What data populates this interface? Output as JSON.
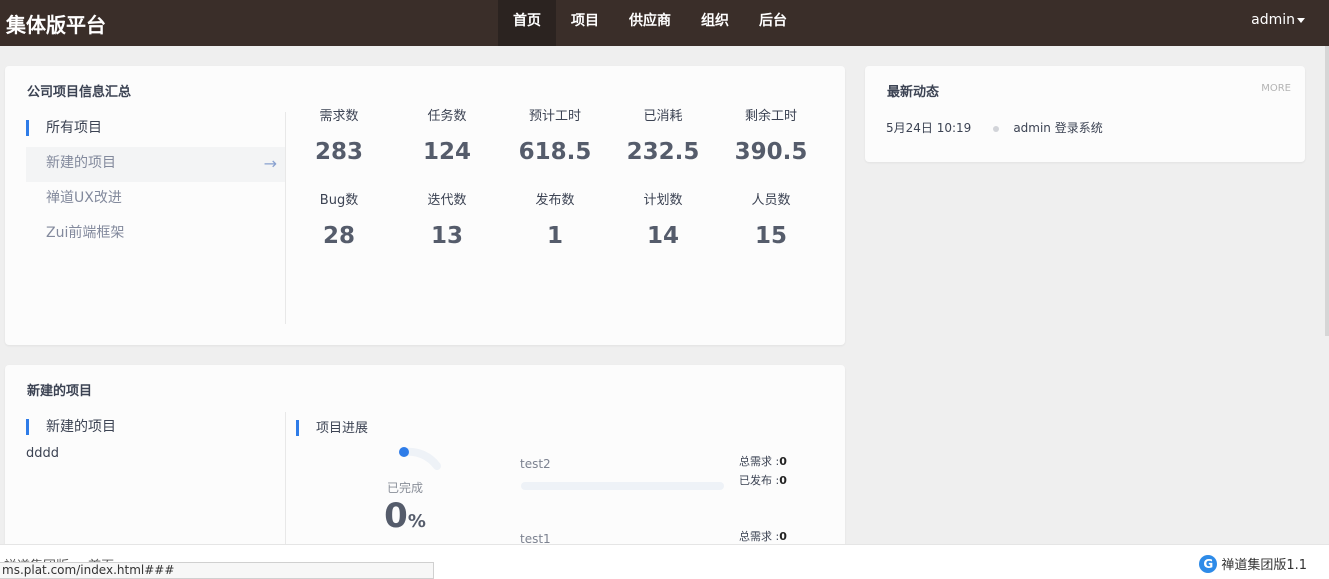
{
  "header": {
    "brand": "集体版平台",
    "nav": [
      "首页",
      "项目",
      "供应商",
      "组织",
      "后台"
    ],
    "active_nav": "首页",
    "user": "admin"
  },
  "summary": {
    "title": "公司项目信息汇总",
    "projects": [
      "所有项目",
      "新建的项目",
      "禅道UX改进",
      "Zui前端框架"
    ],
    "stats": [
      {
        "label": "需求数",
        "value": "283"
      },
      {
        "label": "任务数",
        "value": "124"
      },
      {
        "label": "预计工时",
        "value": "618.5"
      },
      {
        "label": "已消耗",
        "value": "232.5"
      },
      {
        "label": "剩余工时",
        "value": "390.5"
      },
      {
        "label": "Bug数",
        "value": "28"
      },
      {
        "label": "迭代数",
        "value": "13"
      },
      {
        "label": "发布数",
        "value": "1"
      },
      {
        "label": "计划数",
        "value": "14"
      },
      {
        "label": "人员数",
        "value": "15"
      }
    ]
  },
  "news": {
    "title": "最新动态",
    "more": "MORE",
    "items": [
      {
        "time": "5月24日 10:19",
        "text": "admin 登录系统"
      }
    ]
  },
  "new_project": {
    "title": "新建的项目",
    "section_label": "新建的项目",
    "name": "dddd",
    "progress_label": "项目进展",
    "done_label": "已完成",
    "done_value": "0",
    "done_unit": "%",
    "done_fraction": 0,
    "rows": [
      {
        "name": "test2",
        "req_label": "总需求 :",
        "req_value": "0",
        "rel_label": "已发布 :",
        "rel_value": "0",
        "progress": 0
      },
      {
        "name": "test1",
        "req_label": "总需求 :",
        "req_value": "0",
        "progress": 0
      }
    ]
  },
  "footer": {
    "breadcrumb": "禅道集团版 > 首页",
    "version": "禅道集团版1.1",
    "logo_letter": "G",
    "status_url": "ms.plat.com/index.html###"
  },
  "colors": {
    "topbar": "#3a2e29",
    "accent": "#2e7ce8",
    "background": "#efefef"
  }
}
